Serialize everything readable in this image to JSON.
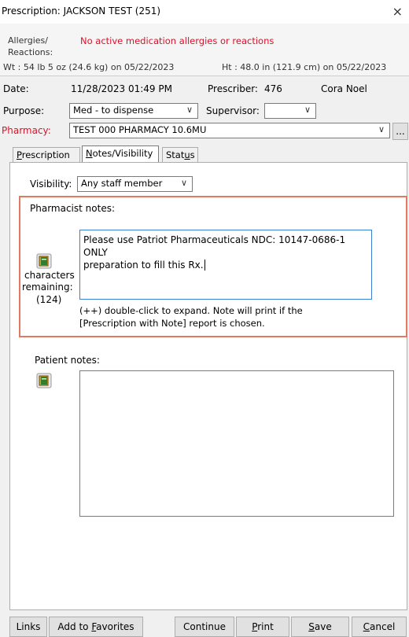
{
  "window": {
    "title": "Prescription: JACKSON TEST (251)",
    "close_glyph": "×"
  },
  "allergy": {
    "label_line1": "Allergies/",
    "label_line2": "Reactions:",
    "value": "No active medication allergies or reactions",
    "weight": "Wt : 54 lb 5 oz (24.6 kg) on 05/22/2023",
    "height": "Ht : 48.0 in (121.9 cm) on 05/22/2023"
  },
  "form": {
    "date_label": "Date:",
    "date_value": "11/28/2023 01:49 PM",
    "prescriber_label": "Prescriber:",
    "prescriber_id": "476",
    "prescriber_name": "Cora Noel",
    "purpose_label": "Purpose:",
    "purpose_value": "Med - to dispense",
    "supervisor_label": "Supervisor:",
    "supervisor_value": "",
    "pharmacy_label": "Pharmacy:",
    "pharmacy_value": "TEST 000 PHARMACY 10.6MU",
    "pharmacy_more": "...",
    "dropdown_glyph": "∨"
  },
  "tabs": [
    {
      "pre": "",
      "u": "P",
      "post": "rescription"
    },
    {
      "pre": "",
      "u": "N",
      "post": "otes/Visibility"
    },
    {
      "pre": "Stat",
      "u": "u",
      "post": "s"
    }
  ],
  "notes": {
    "visibility_label": "Visibility:",
    "visibility_value": "Any staff member",
    "pharmacist_label": "Pharmacist notes:",
    "pharmacist_text_line1": "Please use Patriot Pharmaceuticals NDC: 10147-0686-1 ONLY",
    "pharmacist_text_line2": "preparation to fill this Rx.",
    "chars_line1": "characters",
    "chars_line2": "remaining:",
    "chars_count": "(124)",
    "hint_line1": "(++) double-click to expand. Note will print if the",
    "hint_line2": "[Prescription with Note] report is chosen.",
    "patient_label": "Patient notes:",
    "patient_text": ""
  },
  "footer": {
    "links": "Links",
    "favorites_pre": "Add to ",
    "favorites_u": "F",
    "favorites_post": "avorites",
    "continue": "Continue",
    "print_u": "P",
    "print_post": "rint",
    "save_u": "S",
    "save_post": "ave",
    "cancel_u": "C",
    "cancel_post": "ancel"
  },
  "colors": {
    "accent_red": "#d8132a",
    "highlight_border": "#e07b62",
    "focus_blue": "#3a7fd1"
  }
}
